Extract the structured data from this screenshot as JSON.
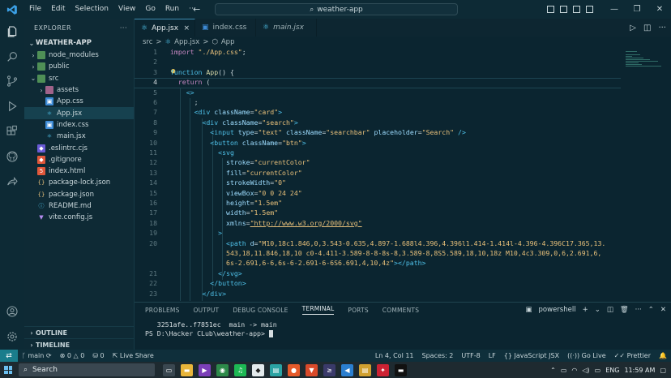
{
  "menu": [
    "File",
    "Edit",
    "Selection",
    "View",
    "Go",
    "Run",
    "···"
  ],
  "search": {
    "text": "weather-app"
  },
  "explorer": {
    "header": "EXPLORER",
    "project": "WEATHER-APP",
    "items": [
      {
        "label": "node_modules",
        "depth": 1,
        "type": "folder",
        "chev": "›",
        "color": "green"
      },
      {
        "label": "public",
        "depth": 1,
        "type": "folder",
        "chev": "›",
        "color": "green"
      },
      {
        "label": "src",
        "depth": 1,
        "type": "folder",
        "chev": "⌄",
        "color": "green"
      },
      {
        "label": "assets",
        "depth": 2,
        "type": "folder",
        "chev": "›",
        "color": "pink"
      },
      {
        "label": "App.css",
        "depth": 2,
        "type": "css"
      },
      {
        "label": "App.jsx",
        "depth": 2,
        "type": "jsx",
        "active": true
      },
      {
        "label": "index.css",
        "depth": 2,
        "type": "css"
      },
      {
        "label": "main.jsx",
        "depth": 2,
        "type": "jsx"
      },
      {
        "label": ".eslintrc.cjs",
        "depth": 1,
        "type": "eslint"
      },
      {
        "label": ".gitignore",
        "depth": 1,
        "type": "git"
      },
      {
        "label": "index.html",
        "depth": 1,
        "type": "html"
      },
      {
        "label": "package-lock.json",
        "depth": 1,
        "type": "json"
      },
      {
        "label": "package.json",
        "depth": 1,
        "type": "json"
      },
      {
        "label": "README.md",
        "depth": 1,
        "type": "md"
      },
      {
        "label": "vite.config.js",
        "depth": 1,
        "type": "vite"
      }
    ],
    "outline": "OUTLINE",
    "timeline": "TIMELINE"
  },
  "tabs": [
    {
      "label": "App.jsx",
      "active": true,
      "close": "×"
    },
    {
      "label": "index.css",
      "active": false
    },
    {
      "label": "main.jsx",
      "active": false
    }
  ],
  "breadcrumb": {
    "part1": "src",
    "sep": ">",
    "part2": "App.jsx",
    "part3": "App"
  },
  "code_lines": [
    {
      "n": "1",
      "html": "<span class='kw'>import</span> <span class='str'>\"./App.css\"</span>;"
    },
    {
      "n": "2",
      "html": ""
    },
    {
      "n": "3",
      "html": "<span class='kw2'>function</span> <span class='fn'>App</span>() {"
    },
    {
      "n": "4",
      "html": "  <span class='kw'>return</span> ("
    },
    {
      "n": "5",
      "html": "    <span class='tag'>&lt;&gt;</span>"
    },
    {
      "n": "6",
      "html": "      ;"
    },
    {
      "n": "7",
      "html": "      <span class='tag'>&lt;div</span> <span class='attr'>className</span>=<span class='str'>\"card\"</span><span class='tag'>&gt;</span>"
    },
    {
      "n": "8",
      "html": "        <span class='tag'>&lt;div</span> <span class='attr'>className</span>=<span class='str'>\"search\"</span><span class='tag'>&gt;</span>"
    },
    {
      "n": "9",
      "html": "          <span class='tag'>&lt;input</span> <span class='attr'>type</span>=<span class='str'>\"text\"</span> <span class='attr'>className</span>=<span class='str'>\"searchbar\"</span> <span class='attr'>placeholder</span>=<span class='str'>\"Search\"</span> <span class='tag'>/&gt;</span>"
    },
    {
      "n": "10",
      "html": "          <span class='tag'>&lt;button</span> <span class='attr'>className</span>=<span class='str'>\"btn\"</span><span class='tag'>&gt;</span>"
    },
    {
      "n": "11",
      "html": "            <span class='tag'>&lt;svg</span>"
    },
    {
      "n": "12",
      "html": "              <span class='attr'>stroke</span>=<span class='str'>\"currentColor\"</span>"
    },
    {
      "n": "13",
      "html": "              <span class='attr'>fill</span>=<span class='str'>\"currentColor\"</span>"
    },
    {
      "n": "14",
      "html": "              <span class='attr'>strokeWidth</span>=<span class='str'>\"0\"</span>"
    },
    {
      "n": "15",
      "html": "              <span class='attr'>viewBox</span>=<span class='str'>\"0 0 24 24\"</span>"
    },
    {
      "n": "16",
      "html": "              <span class='attr'>height</span>=<span class='str'>\"1.5em\"</span>"
    },
    {
      "n": "17",
      "html": "              <span class='attr'>width</span>=<span class='str'>\"1.5em\"</span>"
    },
    {
      "n": "18",
      "html": "              <span class='attr'>xmlns</span>=<span class='link'>\"http://www.w3.org/2000/svg\"</span>"
    },
    {
      "n": "19",
      "html": "            <span class='tag'>&gt;</span>"
    },
    {
      "n": "20",
      "html": "              <span class='tag'>&lt;path</span> <span class='attr'>d</span>=<span class='str'>\"M10,18c1.846,0,3.543-0.635,4.897-1.688l4.396,4.396l1.414-1.414l-4.396-4.396C17.365,13.</span>"
    },
    {
      "n": "",
      "html": "<span class='str'>              543,18,11.846,18,10 c0-4.411-3.589-8-8-8s-8,3.589-8,8S5.589,18,10,18z M10,4c3.309,0,6,2.691,6,</span>"
    },
    {
      "n": "",
      "html": "<span class='str'>              6s-2.691,6-6,6s-6-2.691-6-6S6.691,4,10,4z\"</span><span class='tag'>&gt;&lt;/path&gt;</span>"
    },
    {
      "n": "21",
      "html": "            <span class='tag'>&lt;/svg&gt;</span>"
    },
    {
      "n": "22",
      "html": "          <span class='tag'>&lt;/button&gt;</span>"
    },
    {
      "n": "23",
      "html": "        <span class='tag'>&lt;/div&gt;</span>"
    }
  ],
  "panel": {
    "tabs": [
      "PROBLEMS",
      "OUTPUT",
      "DEBUG CONSOLE",
      "TERMINAL",
      "PORTS",
      "COMMENTS"
    ],
    "active_tab": "TERMINAL",
    "shell": "powershell",
    "lines": [
      "   3251afe..f7851ec  main -> main",
      "PS D:\\Hacker CLub\\weather-app> "
    ]
  },
  "status": {
    "branch": "main",
    "errors": "0",
    "warnings": "0",
    "ports": "0",
    "liveshare": "Live Share",
    "position": "Ln 4, Col 11",
    "spaces": "Spaces: 2",
    "encoding": "UTF-8",
    "eol": "LF",
    "language": "JavaScript JSX",
    "golive": "Go Live",
    "prettier": "Prettier"
  },
  "taskbar": {
    "search": "Search",
    "lang": "ENG",
    "time": "11:59 AM"
  },
  "colors": {
    "accent": "#3d8bb0",
    "remote": "#1a7d8c"
  }
}
